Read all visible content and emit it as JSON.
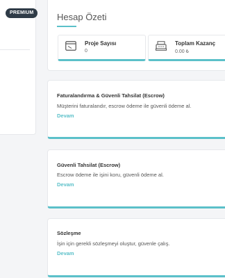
{
  "sidebar": {
    "badge": "PREMIUM"
  },
  "summary": {
    "title": "Hesap Özeti",
    "stats": [
      {
        "label": "Proje Sayısı",
        "value": "0",
        "icon": "browser-window-icon"
      },
      {
        "label": "Toplam Kazanç",
        "value": "0.00 ₺",
        "icon": "cash-register-icon"
      }
    ]
  },
  "features": [
    {
      "title": "Faturalandırma & Güvenli Tahsilat (Escrow)",
      "description": "Müşterini faturalandır, escrow ödeme ile güvenli ödeme al.",
      "link": "Devam"
    },
    {
      "title": "Güvenli Tahsilat (Escrow)",
      "description": "Escrow ödeme ile işini koru, güvenli ödeme al.",
      "link": "Devam"
    },
    {
      "title": "Sözleşme",
      "description": "İşin için gerekli sözleşmeyi oluştur, güvenle çalış.",
      "link": "Devam"
    }
  ],
  "colors": {
    "accent": "#5bc0c9",
    "badge_bg": "#2f3b47"
  }
}
